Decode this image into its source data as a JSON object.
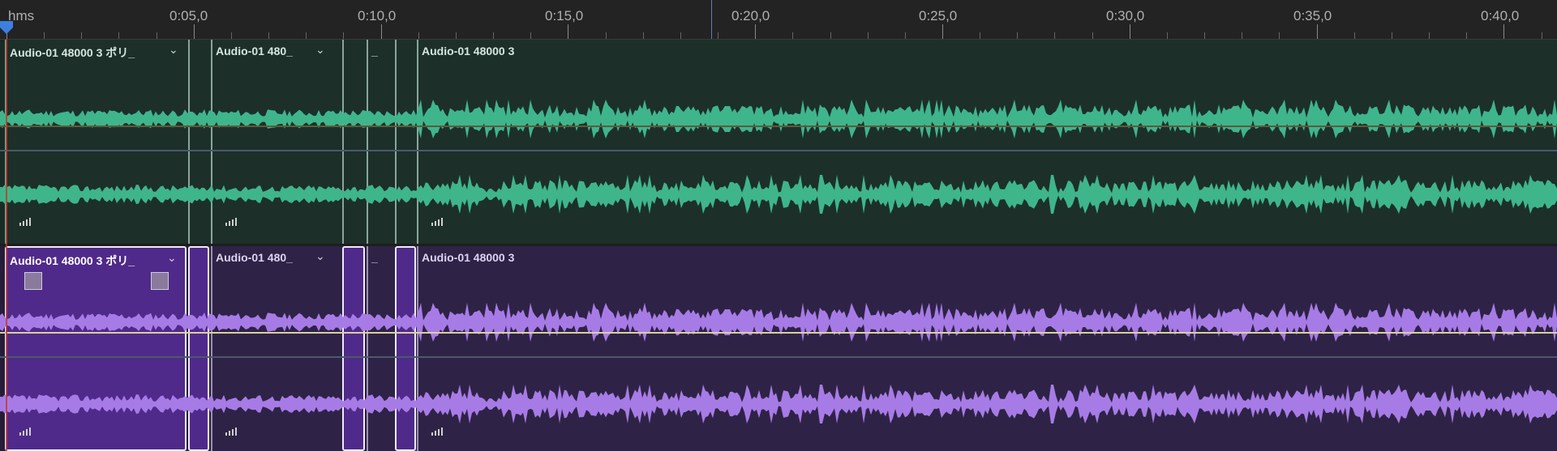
{
  "ruler": {
    "units_label": "hms",
    "ticks": [
      "0:05,0",
      "0:10,0",
      "0:15,0",
      "0:20,0",
      "0:25,0",
      "0:30,0",
      "0:35,0",
      "0:40,0"
    ]
  },
  "tracks": [
    {
      "name": "track-1",
      "color": "#3fb58c",
      "clips": [
        {
          "label": "Audio-01 48000 3 ポリ_",
          "chevron": true
        },
        {
          "label": "",
          "chevron": false
        },
        {
          "label": "Audio-01 480_",
          "chevron": true
        },
        {
          "label": "",
          "chevron": false
        },
        {
          "label": "_",
          "chevron": false
        },
        {
          "label": "",
          "chevron": false
        },
        {
          "label": "Audio-01 48000 3",
          "chevron": false
        }
      ]
    },
    {
      "name": "track-2",
      "color": "#a77be6",
      "clips": [
        {
          "label": "Audio-01 48000 3 ポリ_",
          "chevron": true,
          "selected": true
        },
        {
          "label": "",
          "chevron": false,
          "selected": true
        },
        {
          "label": "Audio-01 480_",
          "chevron": true
        },
        {
          "label": "",
          "chevron": false,
          "selected": true
        },
        {
          "label": "_",
          "chevron": false
        },
        {
          "label": "",
          "chevron": false,
          "selected": true
        },
        {
          "label": "Audio-01 48000 3",
          "chevron": false
        }
      ]
    }
  ]
}
